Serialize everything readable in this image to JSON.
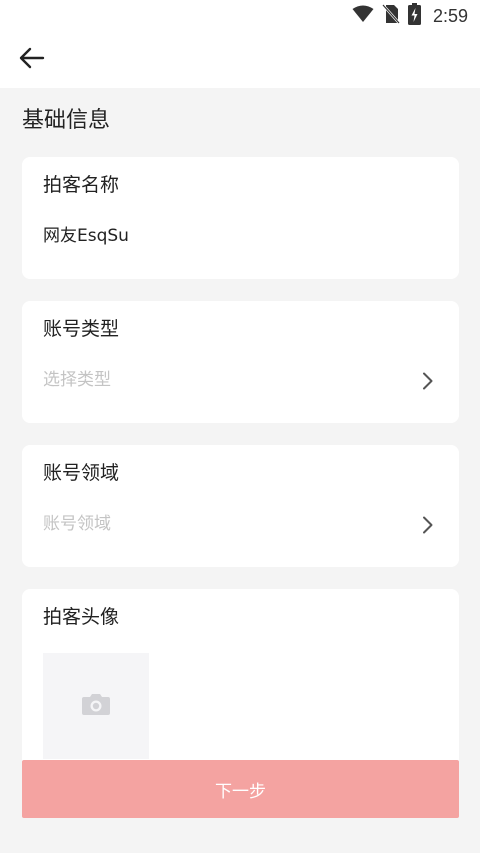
{
  "status_bar": {
    "time": "2:59",
    "icons": [
      "wifi-icon",
      "no-sim-icon",
      "battery-charging-icon"
    ]
  },
  "app_bar": {
    "back_icon": "arrow-left-icon"
  },
  "section": {
    "title": "基础信息"
  },
  "fields": {
    "name": {
      "label": "拍客名称",
      "value": "网友EsqSu"
    },
    "account_type": {
      "label": "账号类型",
      "placeholder": "选择类型",
      "icon": "chevron-right-icon"
    },
    "account_domain": {
      "label": "账号领域",
      "placeholder": "账号领域",
      "icon": "chevron-right-icon"
    },
    "avatar": {
      "label": "拍客头像",
      "icon": "camera-icon"
    }
  },
  "actions": {
    "next_label": "下一步"
  },
  "colors": {
    "background": "#f4f4f4",
    "card": "#ffffff",
    "primary_button": "#f4a3a1",
    "placeholder": "#c4c4c4",
    "text": "#222222"
  }
}
